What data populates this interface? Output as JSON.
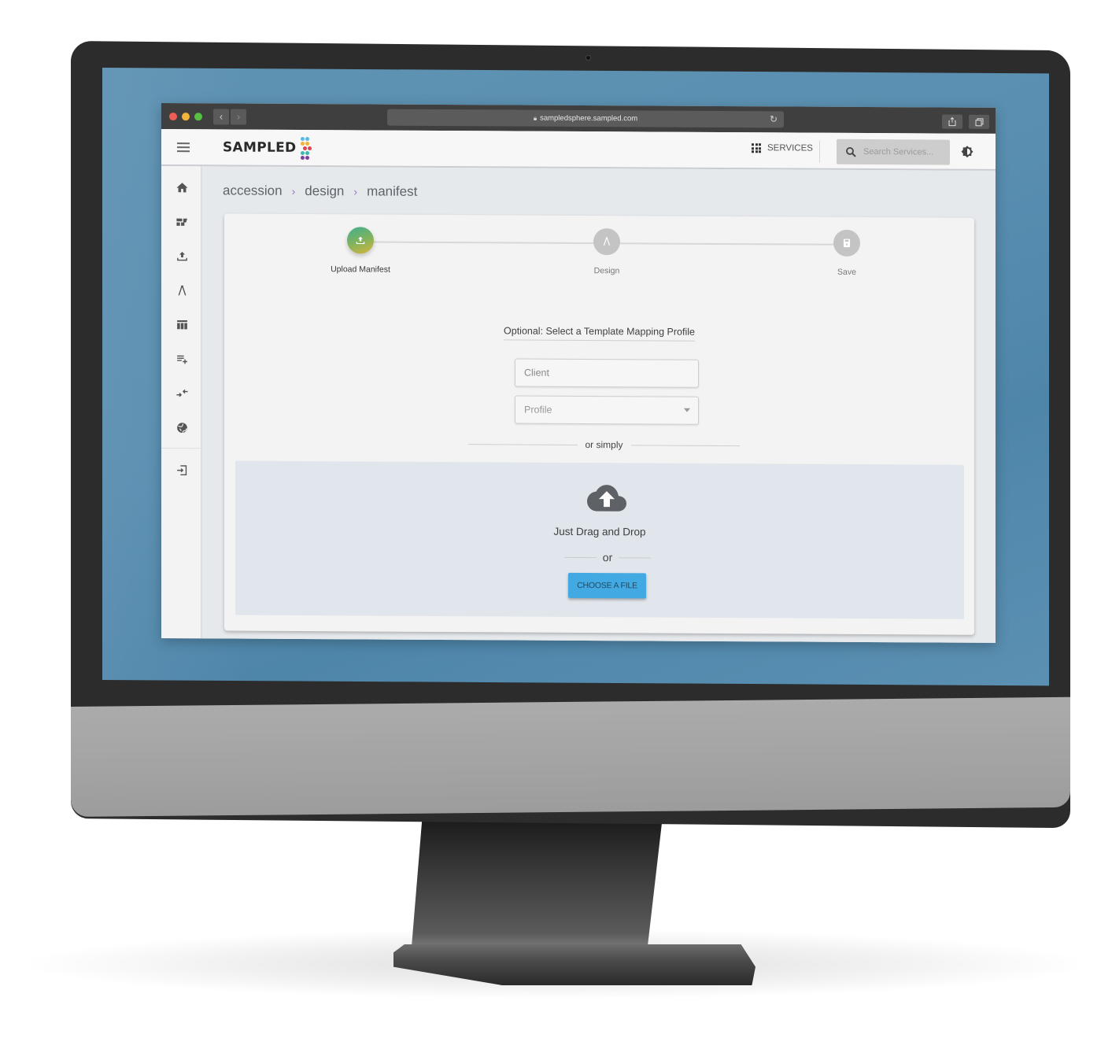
{
  "browser": {
    "url": "sampledsphere.sampled.com",
    "traffic_lights": {
      "close": "#ee5d54",
      "minimize": "#f2b53a",
      "maximize": "#56c041"
    },
    "nav": {
      "back_icon": "chevron-left-icon",
      "forward_icon": "chevron-right-icon"
    },
    "toolbar": {
      "share_icon": "share-icon",
      "tabs_icon": "tabs-icon",
      "reload_icon": "reload-icon",
      "lock_icon": "lock-icon"
    }
  },
  "app": {
    "logo_text": "SAMPLED",
    "logo_dot_colors": [
      "#5cb8e4",
      "#f0b33c",
      "#e0424f",
      "#3fb7a9",
      "#7b3fa0"
    ],
    "header": {
      "services_label": "SERVICES",
      "search_placeholder": "Search Services...",
      "theme_toggle_icon": "brightness-icon"
    },
    "sidebar": {
      "items": [
        {
          "icon": "home-icon"
        },
        {
          "icon": "dashboard-icon"
        },
        {
          "icon": "upload-icon"
        },
        {
          "icon": "compass-design-icon"
        },
        {
          "icon": "table-icon"
        },
        {
          "icon": "playlist-add-icon"
        },
        {
          "icon": "compare-arrows-icon"
        },
        {
          "icon": "globe-icon"
        },
        {
          "icon": "logout-icon"
        }
      ]
    },
    "breadcrumb": [
      "accession",
      "design",
      "manifest"
    ],
    "stepper": {
      "steps": [
        {
          "label": "Upload Manifest",
          "icon": "upload-icon",
          "active": true
        },
        {
          "label": "Design",
          "icon": "compass-design-icon",
          "active": false
        },
        {
          "label": "Save",
          "icon": "save-icon",
          "active": false
        }
      ],
      "active_gradient": [
        "#3fae8f",
        "#d9b53a"
      ]
    },
    "form": {
      "title": "Optional: Select a Template Mapping Profile",
      "client_placeholder": "Client",
      "client_value": "",
      "profile_placeholder": "Profile",
      "separator": "or simply"
    },
    "dropzone": {
      "icon": "cloud-upload-icon",
      "text": "Just Drag and Drop",
      "or": "or",
      "button_label": "CHOOSE A FILE",
      "button_color": "#43a9e3"
    }
  }
}
